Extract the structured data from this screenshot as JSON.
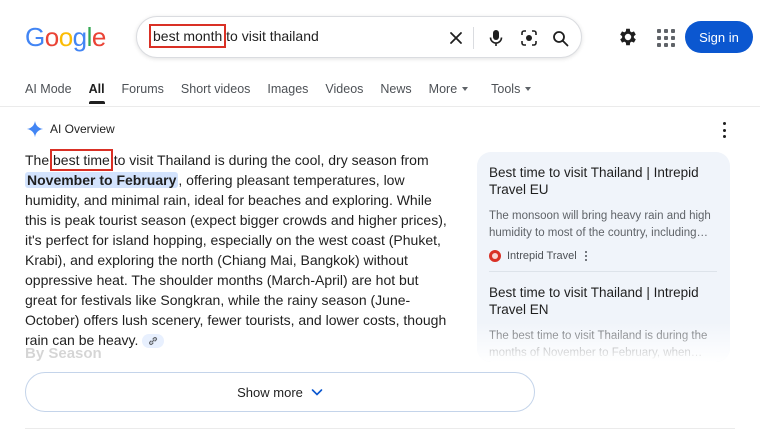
{
  "logo": {
    "letters": [
      "G",
      "o",
      "o",
      "g",
      "l",
      "e"
    ]
  },
  "search": {
    "query_highlight": "best month",
    "query_rest": " to visit thailand"
  },
  "header": {
    "signin_label": "Sign in"
  },
  "tabs": [
    {
      "label": "AI Mode"
    },
    {
      "label": "All",
      "active": true
    },
    {
      "label": "Forums"
    },
    {
      "label": "Short videos"
    },
    {
      "label": "Images"
    },
    {
      "label": "Videos"
    },
    {
      "label": "News"
    },
    {
      "label": "More",
      "dropdown": true
    },
    {
      "label": "Tools",
      "dropdown": true
    }
  ],
  "ai_overview": {
    "title": "AI Overview",
    "para": {
      "p1": "The ",
      "hl": "best time",
      "p2": " to visit Thailand is during the cool, dry season from ",
      "mark": "November to February",
      "p3": ", offering pleasant temperatures, low humidity, and minimal rain, ideal for beaches and exploring. While this is peak tourist season (expect bigger crowds and higher prices), it's perfect for island hopping, especially on the west coast (Phuket, Krabi), and exploring the north (Chiang Mai, Bangkok) without oppressive heat. The shoulder months (March-April) are hot but great for festivals like Songkran, while the rainy season (June-October) offers lush scenery, fewer tourists, and lower costs, though rain can be heavy."
    },
    "section_heading": "By Season",
    "show_more_label": "Show more"
  },
  "sources": [
    {
      "title": "Best time to visit Thailand | Intrepid Travel EU",
      "snippet": "The monsoon will bring heavy rain and high humidity to most of the country, including the...",
      "site": "Intrepid Travel"
    },
    {
      "title": "Best time to visit Thailand | Intrepid Travel EN",
      "snippet": "The best time to visit Thailand is during the months of November to February, when mo..."
    }
  ],
  "colors": {
    "accent": "#0b57d0",
    "highlight_box": "#d93025",
    "mark_bg": "#d3e3fd"
  }
}
